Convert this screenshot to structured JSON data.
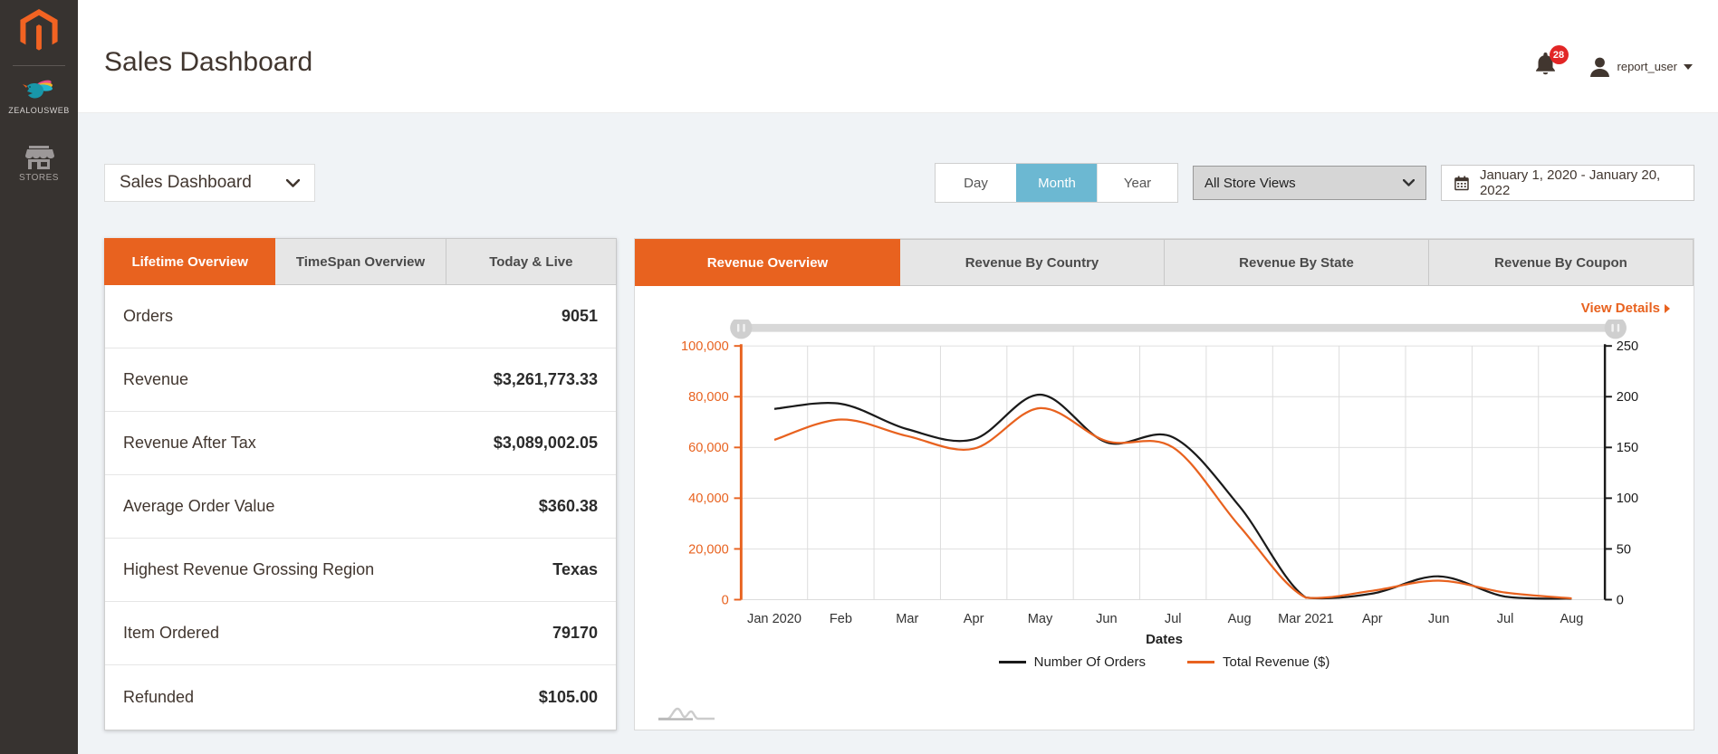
{
  "colors": {
    "accent_orange": "#e8621f",
    "magento_orange": "#f26322",
    "active_period_blue": "#6cb8d2",
    "badge_red": "#e22626",
    "orders_line": "#1a1a1a",
    "revenue_line": "#e8621f"
  },
  "sidebar": {
    "brand": "ZEALOUSWEB",
    "stores": "STORES"
  },
  "header": {
    "title": "Sales Dashboard",
    "notification_count": "28",
    "username": "report_user"
  },
  "toolbar": {
    "dashboard_select": "Sales Dashboard",
    "periods": [
      {
        "label": "Day",
        "active": false
      },
      {
        "label": "Month",
        "active": true
      },
      {
        "label": "Year",
        "active": false
      }
    ],
    "store_view": "All Store Views",
    "date_range": "January 1, 2020 - January 20, 2022"
  },
  "overview_panel": {
    "tabs": [
      {
        "label": "Lifetime Overview",
        "active": true
      },
      {
        "label": "TimeSpan Overview",
        "active": false
      },
      {
        "label": "Today & Live",
        "active": false
      }
    ],
    "rows": [
      {
        "label": "Orders",
        "value": "9051"
      },
      {
        "label": "Revenue",
        "value": "$3,261,773.33"
      },
      {
        "label": "Revenue After Tax",
        "value": "$3,089,002.05"
      },
      {
        "label": "Average Order Value",
        "value": "$360.38"
      },
      {
        "label": "Highest Revenue Grossing Region",
        "value": "Texas"
      },
      {
        "label": "Item Ordered",
        "value": "79170"
      },
      {
        "label": "Refunded",
        "value": "$105.00"
      }
    ]
  },
  "revenue_panel": {
    "tabs": [
      {
        "label": "Revenue Overview",
        "active": true
      },
      {
        "label": "Revenue By Country",
        "active": false
      },
      {
        "label": "Revenue By State",
        "active": false
      },
      {
        "label": "Revenue By Coupon",
        "active": false
      }
    ],
    "view_details": "View Details"
  },
  "chart_data": {
    "type": "line",
    "categories": [
      "Jan 2020",
      "Feb",
      "Mar",
      "Apr",
      "May",
      "Jun",
      "Jul",
      "Aug",
      "Mar 2021",
      "Apr",
      "Jun",
      "Jul",
      "Aug"
    ],
    "series": [
      {
        "name": "Number Of Orders",
        "color": "#1a1a1a",
        "axis": "right",
        "values": [
          188,
          193,
          168,
          158,
          202,
          155,
          160,
          92,
          2,
          6,
          23,
          3,
          1
        ]
      },
      {
        "name": "Total Revenue ($)",
        "color": "#e8621f",
        "axis": "left",
        "values": [
          63000,
          71000,
          64500,
          59500,
          75500,
          62500,
          60000,
          29000,
          800,
          3500,
          7500,
          2800,
          500
        ]
      }
    ],
    "xlabel": "Dates",
    "left_axis": {
      "min": 0,
      "max": 100000,
      "step": 20000,
      "color": "#e8621f"
    },
    "right_axis": {
      "min": 0,
      "max": 250,
      "step": 50,
      "color": "#1a1a1a"
    },
    "grid": true,
    "legend_position": "bottom",
    "range_slider": true
  }
}
